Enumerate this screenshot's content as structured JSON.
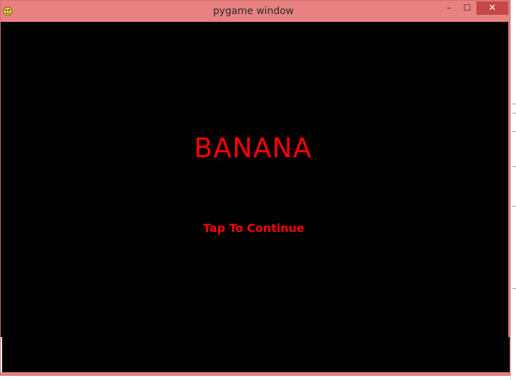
{
  "window": {
    "title": "pygame window",
    "icon": "pygame-snake-icon",
    "controls": {
      "minimize": "–",
      "maximize": "☐",
      "close": "✕"
    },
    "colors": {
      "titlebar": "#e88181",
      "close_button": "#c74646",
      "client_background": "#000000"
    }
  },
  "game": {
    "title": "BANANA",
    "subtitle": "Tap To Continue",
    "text_color": "#ff0000"
  }
}
